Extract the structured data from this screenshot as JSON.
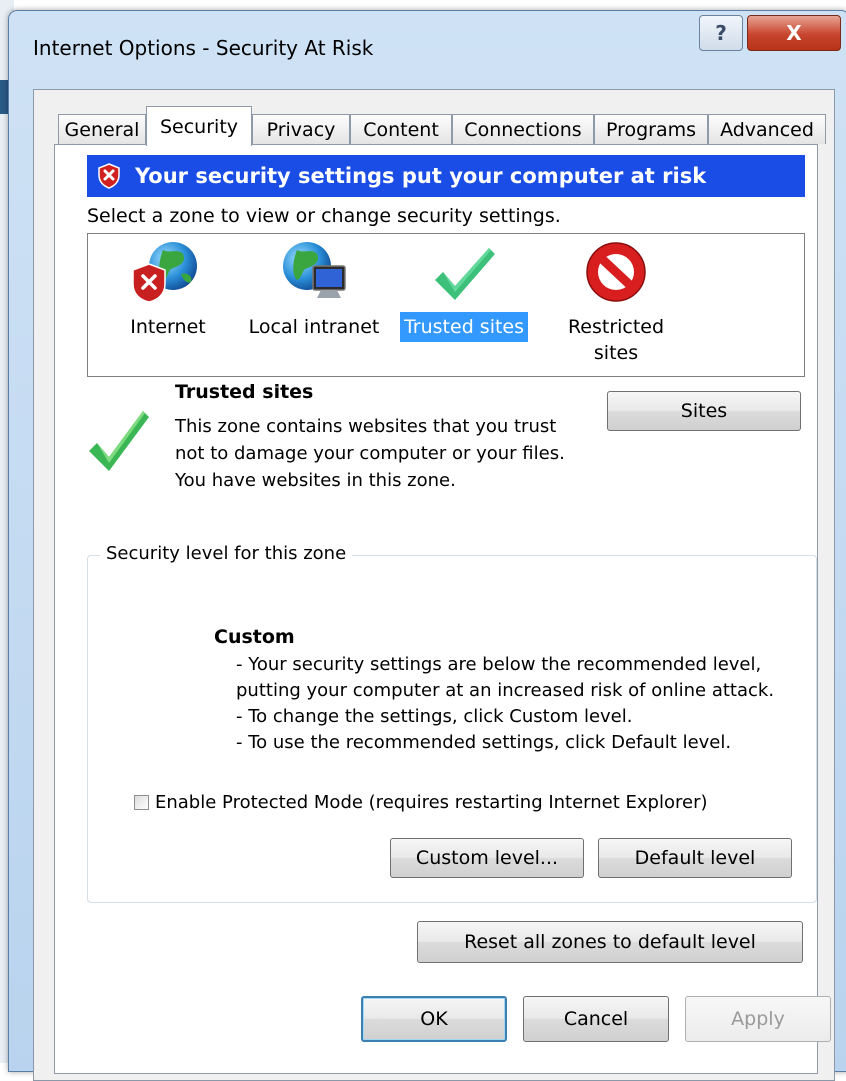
{
  "window": {
    "title": "Internet Options - Security At Risk",
    "help_glyph": "?",
    "close_glyph": "X"
  },
  "tabs": [
    {
      "label": "General",
      "active": false
    },
    {
      "label": "Security",
      "active": true
    },
    {
      "label": "Privacy",
      "active": false
    },
    {
      "label": "Content",
      "active": false
    },
    {
      "label": "Connections",
      "active": false
    },
    {
      "label": "Programs",
      "active": false
    },
    {
      "label": "Advanced",
      "active": false
    }
  ],
  "security": {
    "banner_text": "Your security settings put your computer at risk",
    "banner_color": "#1a4ce6",
    "instruction": "Select a zone to view or change security settings.",
    "zones": [
      {
        "label": "Internet",
        "icon": "globe-shield-icon",
        "selected": false
      },
      {
        "label": "Local intranet",
        "icon": "globe-monitor-icon",
        "selected": false
      },
      {
        "label": "Trusted sites",
        "icon": "checkmark-icon",
        "selected": true
      },
      {
        "label": "Restricted sites",
        "icon": "no-entry-icon",
        "selected": false
      }
    ],
    "selected_zone": {
      "title": "Trusted sites",
      "description": "This zone contains websites that you trust not to damage your computer or your files.",
      "status": "You have websites in this zone.",
      "sites_button": "Sites"
    },
    "level_group": {
      "legend": "Security level for this zone",
      "level_name": "Custom",
      "details": [
        "- Your security settings are below the recommended level, putting your computer at an increased risk of online attack.",
        "- To change the settings, click Custom level.",
        "- To use the recommended settings, click Default level."
      ],
      "protected_mode_label": "Enable Protected Mode (requires restarting Internet Explorer)",
      "protected_mode_checked": false,
      "custom_level_button": "Custom level...",
      "default_level_button": "Default level"
    },
    "reset_button": "Reset all zones to default level"
  },
  "footer": {
    "ok": "OK",
    "cancel": "Cancel",
    "apply": "Apply",
    "apply_enabled": false
  }
}
